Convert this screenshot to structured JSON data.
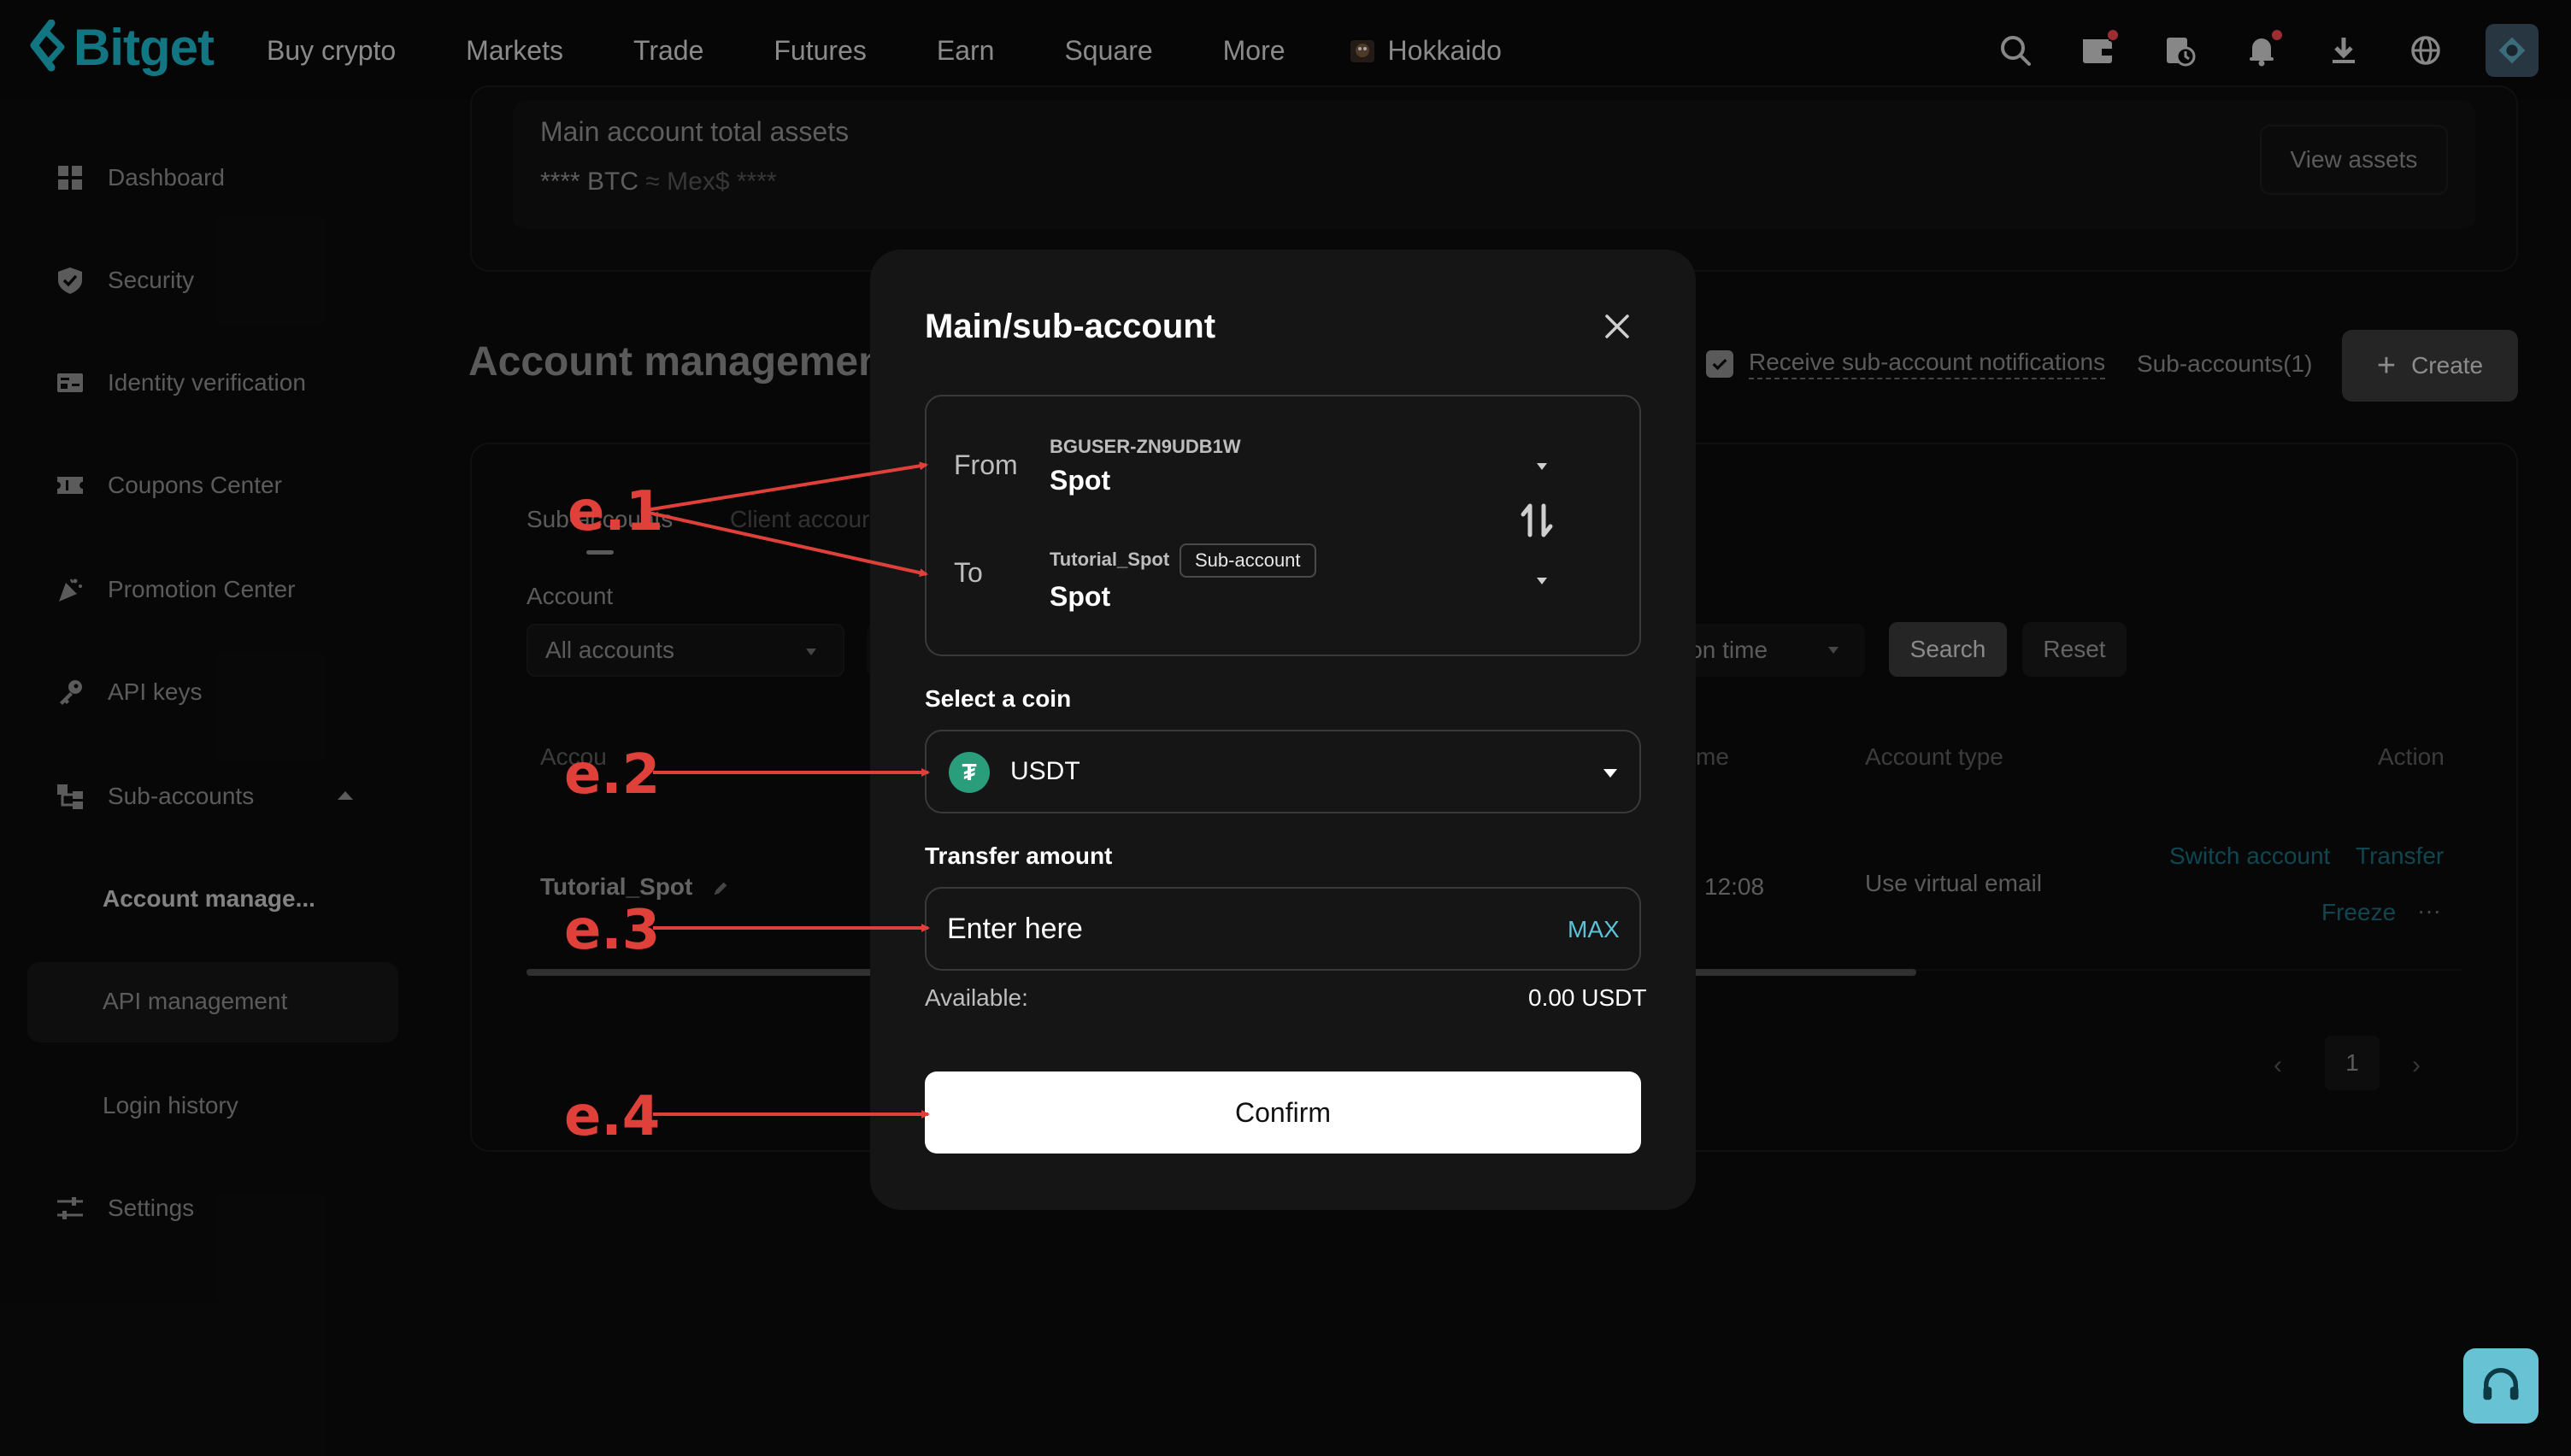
{
  "brand": {
    "logo_text": "Bitget",
    "accent": "#1db5c8"
  },
  "topnav": {
    "items": [
      "Buy crypto",
      "Markets",
      "Trade",
      "Futures",
      "Earn",
      "Square",
      "More",
      "Hokkaido"
    ],
    "icons": [
      "search-icon",
      "wallet-icon",
      "orders-icon",
      "bell-icon",
      "download-icon",
      "globe-icon",
      "avatar"
    ]
  },
  "sidebar": {
    "items": [
      {
        "label": "Dashboard",
        "icon": "dashboard-icon"
      },
      {
        "label": "Security",
        "icon": "shield-icon"
      },
      {
        "label": "Identity verification",
        "icon": "id-card-icon"
      },
      {
        "label": "Coupons Center",
        "icon": "coupon-icon"
      },
      {
        "label": "Promotion Center",
        "icon": "party-icon"
      },
      {
        "label": "API keys",
        "icon": "key-icon"
      },
      {
        "label": "Sub-accounts",
        "icon": "subaccount-icon"
      },
      {
        "label": "Account manage..."
      },
      {
        "label": "API management"
      },
      {
        "label": "Login history"
      },
      {
        "label": "Settings",
        "icon": "sliders-icon"
      }
    ]
  },
  "assets": {
    "title": "Main account total assets",
    "value": "**** BTC",
    "approx": " ≈ Mex$ ****",
    "view_button": "View assets"
  },
  "account_management": {
    "title": "Account management",
    "notifications_label": "Receive sub-account notifications",
    "subaccount_count": "Sub-accounts(1)",
    "create_label": "Create",
    "tabs": [
      "Sub-accounts",
      "Client accour"
    ],
    "filter_label": "Account",
    "filter_value": "All accounts",
    "time_filter": "ion time",
    "search_label": "Search",
    "reset_label": "Reset",
    "columns": [
      "Accou",
      "me",
      "Account type",
      "Action"
    ],
    "rows": [
      {
        "account": "Tutorial_Spot",
        "time": "12:08",
        "type": "Use virtual email",
        "actions": [
          "Switch account",
          "Transfer",
          "Freeze",
          "···"
        ]
      }
    ],
    "pagination": {
      "prev": "‹",
      "page": "1",
      "next": "›"
    }
  },
  "modal": {
    "title": "Main/sub-account",
    "from": {
      "label": "From",
      "account": "BGUSER-ZN9UDB1W",
      "wallet": "Spot"
    },
    "to": {
      "label": "To",
      "account": "Tutorial_Spot",
      "badge": "Sub-account",
      "wallet": "Spot"
    },
    "coin_label": "Select a coin",
    "coin": "USDT",
    "coin_symbol": "₮",
    "amount_label": "Transfer amount",
    "amount_placeholder": "Enter here",
    "max_label": "MAX",
    "available_label": "Available:",
    "available_value": "0.00 USDT",
    "confirm_label": "Confirm"
  },
  "annotations": {
    "e1": "e.1",
    "e2": "e.2",
    "e3": "e.3",
    "e4": "e.4",
    "color": "#e0403a"
  }
}
